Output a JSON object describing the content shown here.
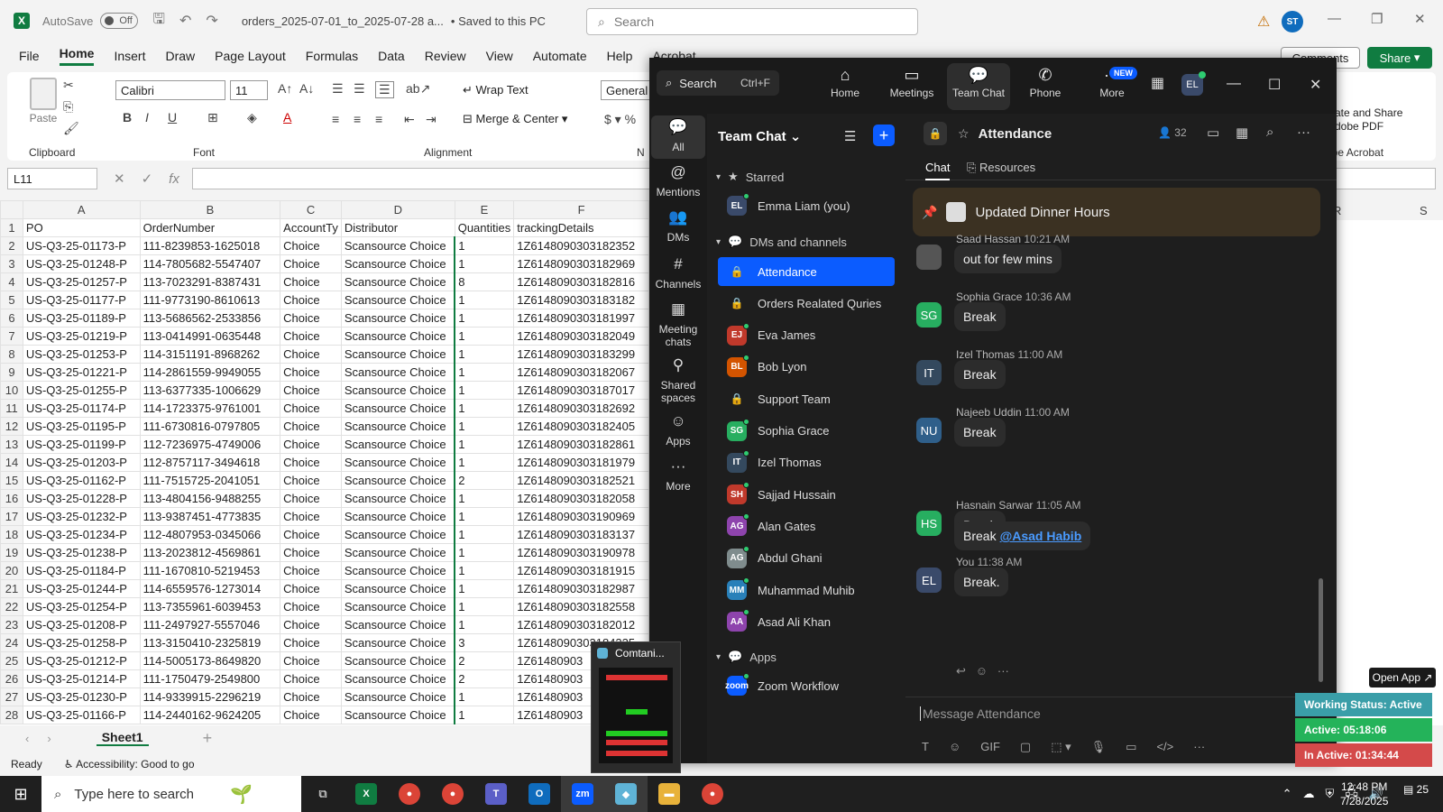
{
  "excel": {
    "autosave_label": "AutoSave",
    "autosave_state": "Off",
    "filename": "orders_2025-07-01_to_2025-07-28 a...",
    "saved_state": "Saved to this PC",
    "search_placeholder": "Search",
    "user_initials": "ST",
    "menu": [
      "File",
      "Home",
      "Insert",
      "Draw",
      "Page Layout",
      "Formulas",
      "Data",
      "Review",
      "View",
      "Automate",
      "Help",
      "Acrobat"
    ],
    "active_menu": "Home",
    "comments_label": "Comments",
    "share_label": "Share",
    "ribbon": {
      "paste": "Paste",
      "clipboard": "Clipboard",
      "font_name": "Calibri",
      "font_size": "11",
      "font_group": "Font",
      "wrap_text": "Wrap Text",
      "merge_center": "Merge & Center",
      "alignment_group": "Alignment",
      "number_format": "General",
      "number_group_partial": "N",
      "acrobat_line1": "ate and Share",
      "acrobat_line2": "dobe PDF",
      "acrobat_group": "obe Acrobat"
    },
    "name_box": "L11",
    "columns": [
      "A",
      "B",
      "C",
      "D",
      "E",
      "F"
    ],
    "right_columns": [
      "R",
      "S"
    ],
    "headers": [
      "PO",
      "OrderNumber",
      "AccountTy",
      "Distributor",
      "Quantities",
      "trackingDetails"
    ],
    "rows": [
      [
        "US-Q3-25-01173-P",
        "111-8239853-1625018",
        "Choice",
        "Scansource Choice",
        "1",
        "1Z6148090303182352"
      ],
      [
        "US-Q3-25-01248-P",
        "114-7805682-5547407",
        "Choice",
        "Scansource Choice",
        "1",
        "1Z6148090303182969"
      ],
      [
        "US-Q3-25-01257-P",
        "113-7023291-8387431",
        "Choice",
        "Scansource Choice",
        "8",
        "1Z6148090303182816"
      ],
      [
        "US-Q3-25-01177-P",
        "111-9773190-8610613",
        "Choice",
        "Scansource Choice",
        "1",
        "1Z6148090303183182"
      ],
      [
        "US-Q3-25-01189-P",
        "113-5686562-2533856",
        "Choice",
        "Scansource Choice",
        "1",
        "1Z6148090303181997"
      ],
      [
        "US-Q3-25-01219-P",
        "113-0414991-0635448",
        "Choice",
        "Scansource Choice",
        "1",
        "1Z6148090303182049"
      ],
      [
        "US-Q3-25-01253-P",
        "114-3151191-8968262",
        "Choice",
        "Scansource Choice",
        "1",
        "1Z6148090303183299"
      ],
      [
        "US-Q3-25-01221-P",
        "114-2861559-9949055",
        "Choice",
        "Scansource Choice",
        "1",
        "1Z6148090303182067"
      ],
      [
        "US-Q3-25-01255-P",
        "113-6377335-1006629",
        "Choice",
        "Scansource Choice",
        "1",
        "1Z6148090303187017"
      ],
      [
        "US-Q3-25-01174-P",
        "114-1723375-9761001",
        "Choice",
        "Scansource Choice",
        "1",
        "1Z6148090303182692"
      ],
      [
        "US-Q3-25-01195-P",
        "111-6730816-0797805",
        "Choice",
        "Scansource Choice",
        "1",
        "1Z6148090303182405"
      ],
      [
        "US-Q3-25-01199-P",
        "112-7236975-4749006",
        "Choice",
        "Scansource Choice",
        "1",
        "1Z6148090303182861"
      ],
      [
        "US-Q3-25-01203-P",
        "112-8757117-3494618",
        "Choice",
        "Scansource Choice",
        "1",
        "1Z6148090303181979"
      ],
      [
        "US-Q3-25-01162-P",
        "111-7515725-2041051",
        "Choice",
        "Scansource Choice",
        "2",
        "1Z6148090303182521"
      ],
      [
        "US-Q3-25-01228-P",
        "113-4804156-9488255",
        "Choice",
        "Scansource Choice",
        "1",
        "1Z6148090303182058"
      ],
      [
        "US-Q3-25-01232-P",
        "113-9387451-4773835",
        "Choice",
        "Scansource Choice",
        "1",
        "1Z6148090303190969"
      ],
      [
        "US-Q3-25-01234-P",
        "112-4807953-0345066",
        "Choice",
        "Scansource Choice",
        "1",
        "1Z6148090303183137"
      ],
      [
        "US-Q3-25-01238-P",
        "113-2023812-4569861",
        "Choice",
        "Scansource Choice",
        "1",
        "1Z6148090303190978"
      ],
      [
        "US-Q3-25-01184-P",
        "111-1670810-5219453",
        "Choice",
        "Scansource Choice",
        "1",
        "1Z6148090303181915"
      ],
      [
        "US-Q3-25-01244-P",
        "114-6559576-1273014",
        "Choice",
        "Scansource Choice",
        "1",
        "1Z6148090303182987"
      ],
      [
        "US-Q3-25-01254-P",
        "113-7355961-6039453",
        "Choice",
        "Scansource Choice",
        "1",
        "1Z6148090303182558"
      ],
      [
        "US-Q3-25-01208-P",
        "111-2497927-5557046",
        "Choice",
        "Scansource Choice",
        "1",
        "1Z6148090303182012"
      ],
      [
        "US-Q3-25-01258-P",
        "113-3150410-2325819",
        "Choice",
        "Scansource Choice",
        "3",
        "1Z6148090303184225"
      ],
      [
        "US-Q3-25-01212-P",
        "114-5005173-8649820",
        "Choice",
        "Scansource Choice",
        "2",
        "1Z61480903"
      ],
      [
        "US-Q3-25-01214-P",
        "111-1750479-2549800",
        "Choice",
        "Scansource Choice",
        "2",
        "1Z61480903"
      ],
      [
        "US-Q3-25-01230-P",
        "114-9339915-2296219",
        "Choice",
        "Scansource Choice",
        "1",
        "1Z61480903"
      ],
      [
        "US-Q3-25-01166-P",
        "114-2440162-9624205",
        "Choice",
        "Scansource Choice",
        "1",
        "1Z61480903"
      ]
    ],
    "sheet_name": "Sheet1",
    "status_ready": "Ready",
    "accessibility": "Accessibility: Good to go"
  },
  "zoom": {
    "search_label": "Search",
    "search_shortcut": "Ctrl+F",
    "nav": [
      "Home",
      "Meetings",
      "Team Chat",
      "Phone",
      "More"
    ],
    "active_nav": "Team Chat",
    "new_badge": "NEW",
    "user_initials": "EL",
    "rail": [
      {
        "label": "All",
        "icon": "chat-bubble-icon"
      },
      {
        "label": "Mentions",
        "icon": "at-icon"
      },
      {
        "label": "DMs",
        "icon": "people-icon"
      },
      {
        "label": "Channels",
        "icon": "hash-icon"
      },
      {
        "label": "Meeting chats",
        "icon": "calendar-icon"
      },
      {
        "label": "Shared spaces",
        "icon": "share-icon"
      },
      {
        "label": "Apps",
        "icon": "apps-icon"
      },
      {
        "label": "More",
        "icon": "more-icon"
      }
    ],
    "list_title": "Team Chat",
    "starred_label": "Starred",
    "starred": [
      {
        "name": "Emma Liam (you)",
        "initials": "EL",
        "color": "#3a4a6a"
      }
    ],
    "dms_label": "DMs and channels",
    "channels": [
      {
        "name": "Attendance",
        "type": "lock",
        "active": true
      },
      {
        "name": "Orders Realated Quries",
        "type": "lock"
      },
      {
        "name": "Eva James",
        "initials": "EJ",
        "color": "#c0392b"
      },
      {
        "name": "Bob Lyon",
        "initials": "BL",
        "color": "#d35400"
      },
      {
        "name": "Support Team",
        "type": "lock"
      },
      {
        "name": "Sophia Grace",
        "initials": "SG",
        "color": "#27ae60"
      },
      {
        "name": "Izel Thomas",
        "initials": "IT",
        "color": "#34495e"
      },
      {
        "name": "Sajjad Hussain",
        "initials": "SH",
        "color": "#c0392b"
      },
      {
        "name": "Alan Gates",
        "initials": "AG",
        "color": "#8e44ad"
      },
      {
        "name": "Abdul Ghani",
        "initials": "AG",
        "color": "#7f8c8d"
      },
      {
        "name": "Muhammad Muhib",
        "initials": "MM",
        "color": "#2980b9"
      },
      {
        "name": "Asad Ali Khan",
        "initials": "AA",
        "color": "#8e44ad"
      }
    ],
    "apps_label": "Apps",
    "apps": [
      {
        "name": "Zoom Workflow",
        "initials": "zoom",
        "color": "#0b5cff"
      }
    ],
    "channel_title": "Attendance",
    "member_count": "32",
    "tab_chat": "Chat",
    "tab_resources": "Resources",
    "pinned": "Updated Dinner Hours",
    "messages": [
      {
        "sender": "Saad Hassan",
        "time": "10:21 AM",
        "text": "out for few mins",
        "initials": "",
        "color": "#555"
      },
      {
        "sender": "Sophia Grace",
        "time": "10:36 AM",
        "text": "Break",
        "initials": "SG",
        "color": "#27ae60"
      },
      {
        "sender": "Izel Thomas",
        "time": "11:00 AM",
        "text": "Break",
        "initials": "IT",
        "color": "#34495e"
      },
      {
        "sender": "Najeeb Uddin",
        "time": "11:00 AM",
        "text": "Break",
        "initials": "NU",
        "color": "#2f5f8a"
      },
      {
        "sender": "Hasnain Sarwar",
        "time": "11:05 AM",
        "text": "Break",
        "initials": "HS",
        "color": "#27ae60"
      },
      {
        "sender": "You",
        "time": "11:38 AM",
        "text": "Break.",
        "initials": "EL",
        "color": "#3a4a6a"
      }
    ],
    "extra_text": "Break",
    "mention": "@Asad Habib",
    "compose_placeholder": "Message Attendance"
  },
  "widget": {
    "open_app": "Open App",
    "status": "Working Status: Active",
    "active": "Active: 05:18:06",
    "inactive": "In Active: 01:34:44"
  },
  "taskbar": {
    "search_placeholder": "Type here to search",
    "thumb_title": "Comtani...",
    "time": "12:48 PM",
    "date": "7/28/2025",
    "notifications": "25"
  }
}
